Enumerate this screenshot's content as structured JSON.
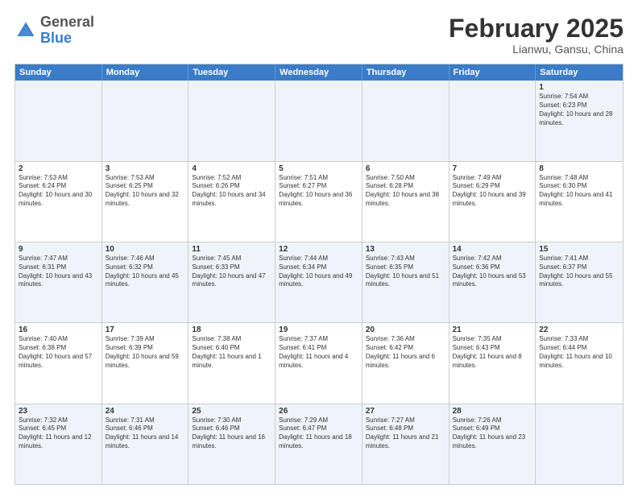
{
  "header": {
    "logo_general": "General",
    "logo_blue": "Blue",
    "month": "February 2025",
    "location": "Lianwu, Gansu, China"
  },
  "days_of_week": [
    "Sunday",
    "Monday",
    "Tuesday",
    "Wednesday",
    "Thursday",
    "Friday",
    "Saturday"
  ],
  "rows": [
    [
      {
        "day": "",
        "info": ""
      },
      {
        "day": "",
        "info": ""
      },
      {
        "day": "",
        "info": ""
      },
      {
        "day": "",
        "info": ""
      },
      {
        "day": "",
        "info": ""
      },
      {
        "day": "",
        "info": ""
      },
      {
        "day": "1",
        "info": "Sunrise: 7:54 AM\nSunset: 6:23 PM\nDaylight: 10 hours and 28 minutes."
      }
    ],
    [
      {
        "day": "2",
        "info": "Sunrise: 7:53 AM\nSunset: 6:24 PM\nDaylight: 10 hours and 30 minutes."
      },
      {
        "day": "3",
        "info": "Sunrise: 7:53 AM\nSunset: 6:25 PM\nDaylight: 10 hours and 32 minutes."
      },
      {
        "day": "4",
        "info": "Sunrise: 7:52 AM\nSunset: 6:26 PM\nDaylight: 10 hours and 34 minutes."
      },
      {
        "day": "5",
        "info": "Sunrise: 7:51 AM\nSunset: 6:27 PM\nDaylight: 10 hours and 36 minutes."
      },
      {
        "day": "6",
        "info": "Sunrise: 7:50 AM\nSunset: 6:28 PM\nDaylight: 10 hours and 38 minutes."
      },
      {
        "day": "7",
        "info": "Sunrise: 7:49 AM\nSunset: 6:29 PM\nDaylight: 10 hours and 39 minutes."
      },
      {
        "day": "8",
        "info": "Sunrise: 7:48 AM\nSunset: 6:30 PM\nDaylight: 10 hours and 41 minutes."
      }
    ],
    [
      {
        "day": "9",
        "info": "Sunrise: 7:47 AM\nSunset: 6:31 PM\nDaylight: 10 hours and 43 minutes."
      },
      {
        "day": "10",
        "info": "Sunrise: 7:46 AM\nSunset: 6:32 PM\nDaylight: 10 hours and 45 minutes."
      },
      {
        "day": "11",
        "info": "Sunrise: 7:45 AM\nSunset: 6:33 PM\nDaylight: 10 hours and 47 minutes."
      },
      {
        "day": "12",
        "info": "Sunrise: 7:44 AM\nSunset: 6:34 PM\nDaylight: 10 hours and 49 minutes."
      },
      {
        "day": "13",
        "info": "Sunrise: 7:43 AM\nSunset: 6:35 PM\nDaylight: 10 hours and 51 minutes."
      },
      {
        "day": "14",
        "info": "Sunrise: 7:42 AM\nSunset: 6:36 PM\nDaylight: 10 hours and 53 minutes."
      },
      {
        "day": "15",
        "info": "Sunrise: 7:41 AM\nSunset: 6:37 PM\nDaylight: 10 hours and 55 minutes."
      }
    ],
    [
      {
        "day": "16",
        "info": "Sunrise: 7:40 AM\nSunset: 6:38 PM\nDaylight: 10 hours and 57 minutes."
      },
      {
        "day": "17",
        "info": "Sunrise: 7:39 AM\nSunset: 6:39 PM\nDaylight: 10 hours and 59 minutes."
      },
      {
        "day": "18",
        "info": "Sunrise: 7:38 AM\nSunset: 6:40 PM\nDaylight: 11 hours and 1 minute."
      },
      {
        "day": "19",
        "info": "Sunrise: 7:37 AM\nSunset: 6:41 PM\nDaylight: 11 hours and 4 minutes."
      },
      {
        "day": "20",
        "info": "Sunrise: 7:36 AM\nSunset: 6:42 PM\nDaylight: 11 hours and 6 minutes."
      },
      {
        "day": "21",
        "info": "Sunrise: 7:35 AM\nSunset: 6:43 PM\nDaylight: 11 hours and 8 minutes."
      },
      {
        "day": "22",
        "info": "Sunrise: 7:33 AM\nSunset: 6:44 PM\nDaylight: 11 hours and 10 minutes."
      }
    ],
    [
      {
        "day": "23",
        "info": "Sunrise: 7:32 AM\nSunset: 6:45 PM\nDaylight: 11 hours and 12 minutes."
      },
      {
        "day": "24",
        "info": "Sunrise: 7:31 AM\nSunset: 6:46 PM\nDaylight: 11 hours and 14 minutes."
      },
      {
        "day": "25",
        "info": "Sunrise: 7:30 AM\nSunset: 6:46 PM\nDaylight: 11 hours and 16 minutes."
      },
      {
        "day": "26",
        "info": "Sunrise: 7:29 AM\nSunset: 6:47 PM\nDaylight: 11 hours and 18 minutes."
      },
      {
        "day": "27",
        "info": "Sunrise: 7:27 AM\nSunset: 6:48 PM\nDaylight: 11 hours and 21 minutes."
      },
      {
        "day": "28",
        "info": "Sunrise: 7:26 AM\nSunset: 6:49 PM\nDaylight: 11 hours and 23 minutes."
      },
      {
        "day": "",
        "info": ""
      }
    ]
  ]
}
